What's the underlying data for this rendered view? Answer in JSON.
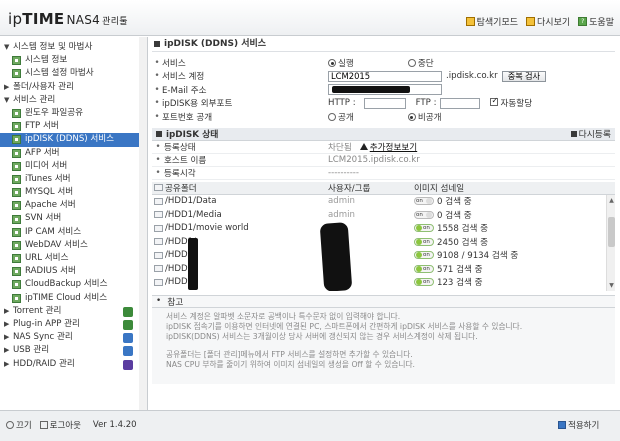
{
  "header": {
    "brand_prefix": "ip",
    "brand_bold": "TIME",
    "brand_model": "NAS4",
    "brand_sub": "관리툴",
    "nav": [
      {
        "label": "탐색기모드",
        "icon": "folder-icon"
      },
      {
        "label": "다시보기",
        "icon": "refresh-icon"
      },
      {
        "label": "도움말",
        "icon": "help-icon"
      }
    ]
  },
  "sidebar": {
    "groups": [
      {
        "label": "시스템 정보 및 마법사",
        "expanded": true,
        "items": [
          "시스템 정보",
          "시스템 설정 마법사"
        ]
      },
      {
        "label": "폴더/사용자 관리",
        "expanded": false,
        "items": []
      },
      {
        "label": "서비스 관리",
        "expanded": true,
        "items": [
          "윈도우 파일공유",
          "FTP 서버",
          "ipDISK (DDNS) 서비스",
          "AFP 서버",
          "미디어 서버",
          "iTunes 서버",
          "MYSQL 서버",
          "Apache 서버",
          "SVN 서버",
          "IP CAM 서비스",
          "WebDAV 서비스",
          "URL 서비스",
          "RADIUS 서버",
          "CloudBackup 서비스",
          "ipTIME Cloud 서비스"
        ]
      },
      {
        "label": "Torrent 관리",
        "expanded": false,
        "items": []
      },
      {
        "label": "Plug-in APP 관리",
        "expanded": false,
        "items": []
      },
      {
        "label": "NAS Sync 관리",
        "expanded": false,
        "items": []
      },
      {
        "label": "USB 관리",
        "expanded": false,
        "items": []
      },
      {
        "label": "HDD/RAID 관리",
        "expanded": false,
        "items": []
      }
    ],
    "selected": "ipDISK (DDNS) 서비스"
  },
  "footer": {
    "power_label": "끄기",
    "logout_label": "로그아웃",
    "version": "Ver 1.4.20",
    "apply_label": "적용하기"
  },
  "main": {
    "section_title": "ipDISK (DDNS) 서비스",
    "settings": {
      "service_label": "서비스",
      "service_on": "실행",
      "service_off": "중단",
      "account_label": "서비스 계정",
      "account_value": "LCM2015",
      "account_suffix": ".ipdisk.co.kr",
      "dup_check_label": "중복 검사",
      "email_label": "E-Mail 주소",
      "ext_port_label": "ipDISK용 외부포트",
      "http_label": "HTTP :",
      "ftp_label": "FTP :",
      "auto_assign_label": "자동할당",
      "port_public_label": "포트번호 공개",
      "public_label": "공개",
      "private_label": "비공개"
    },
    "status": {
      "title": "ipDISK 상태",
      "refresh_label": "다시등록",
      "reg_status_label": "등록상태",
      "reg_status_value": "차단됨",
      "more_info_label": "추가정보보기",
      "host_label": "호스트 이름",
      "host_value": "LCM2015.ipdisk.co.kr",
      "reg_time_label": "등록시각",
      "reg_time_value": "----------"
    },
    "table": {
      "headers": [
        "공유폴더",
        "사용자/그룹",
        "이미지 섬네일"
      ],
      "rows": [
        {
          "folder": "/HDD1/Data",
          "user": "admin",
          "thumb_on": false,
          "thumb_text": "0 검색 중"
        },
        {
          "folder": "/HDD1/Media",
          "user": "admin",
          "thumb_on": false,
          "thumb_text": "0 검색 중"
        },
        {
          "folder": "/HDD1/movie world",
          "user": "",
          "thumb_on": true,
          "thumb_text": "1558 검색 중"
        },
        {
          "folder": "/HDD1/",
          "user": "",
          "thumb_on": true,
          "thumb_text": "2450 검색 중"
        },
        {
          "folder": "/HDD1/",
          "user": "",
          "thumb_on": true,
          "thumb_text": "9108 / 9134 검색 중"
        },
        {
          "folder": "/HDD1/",
          "user": "",
          "thumb_on": true,
          "thumb_text": "571 검색 중"
        },
        {
          "folder": "/HDD1/",
          "user": "",
          "thumb_on": true,
          "thumb_text": "123 검색 중"
        }
      ],
      "toggle_text": "on"
    },
    "notes": {
      "title": "참고",
      "lines": [
        "서비스 계정은 알파벳 소문자로 공백이나 특수문자 없이 입력해야 합니다.",
        "ipDISK 접속기를 이용하면 인터넷에 연결된 PC, 스마트폰에서 간편하게 ipDISK 서비스를 사용할 수 있습니다.",
        "ipDISK(DDNS) 서비스는 3개월이상 당사 서버에 갱신되지 않는 경우 서비스계정이 삭제 됩니다.",
        "",
        "공유폴더는 [폴더 관리]메뉴에서 FTP 서비스를 설정하면 추가할 수 있습니다.",
        "NAS CPU 부하를 줄이기 위하여 이미지 섬네일의 생성을 Off 할 수 있습니다."
      ]
    }
  },
  "colors": {
    "selected_bg": "#3a76c4",
    "page_icon": "#6ea95f",
    "toggle_on": "#8cc63f"
  }
}
